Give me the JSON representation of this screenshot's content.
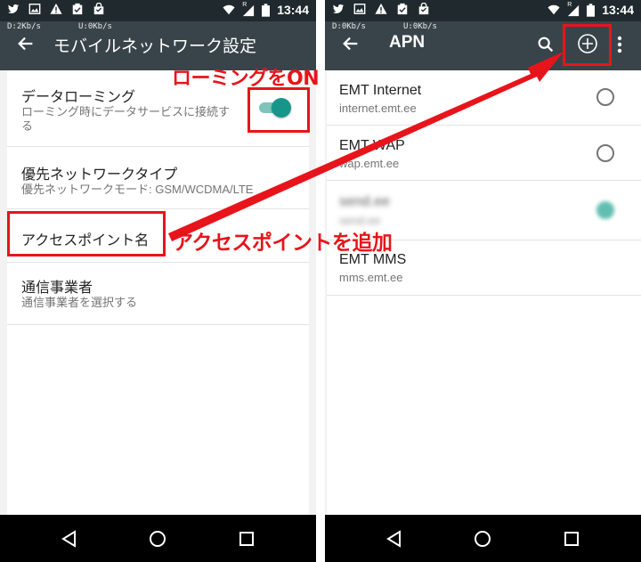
{
  "status_bar": {
    "time": "13:44",
    "roaming_indicator": "R",
    "left_icons": [
      "twitter-icon",
      "image-icon",
      "warning-icon",
      "clipboard-check-icon",
      "bag-icon"
    ],
    "right_icons": [
      "wifi-icon",
      "signal-icon",
      "battery-icon"
    ]
  },
  "left_screen": {
    "speed_down": "D:2Kb/s",
    "speed_up": "U:0Kb/s",
    "title": "モバイルネットワーク設定",
    "items": [
      {
        "title": "データローミング",
        "subtitle": "ローミング時にデータサービスに接続する",
        "toggle_on": true
      },
      {
        "title": "優先ネットワークタイプ",
        "subtitle": "優先ネットワークモード: GSM/WCDMA/LTE"
      },
      {
        "title": "アクセスポイント名"
      },
      {
        "title": "通信事業者",
        "subtitle": "通信事業者を選択する"
      }
    ]
  },
  "right_screen": {
    "speed_down": "D:0Kb/s",
    "speed_up": "U:0Kb/s",
    "title": "APN",
    "apns": [
      {
        "name": "EMT Internet",
        "apn": "internet.emt.ee",
        "selected": false
      },
      {
        "name": "EMT WAP",
        "apn": "wap.emt.ee",
        "selected": false
      },
      {
        "name": "send.ee",
        "apn": "send.ee",
        "selected": true,
        "blurred": true
      },
      {
        "name": "EMT MMS",
        "apn": "mms.emt.ee"
      }
    ]
  },
  "annotations": {
    "roaming_on": "ローミングをON",
    "add_apn": "アクセスポイントを追加",
    "color": "#e8141b"
  }
}
